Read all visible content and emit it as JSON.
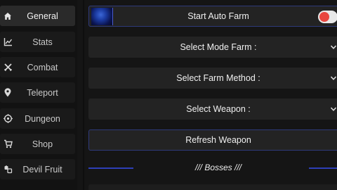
{
  "sidebar": {
    "items": [
      {
        "label": "General",
        "icon": "home-icon",
        "active": true
      },
      {
        "label": "Stats",
        "icon": "chart-icon",
        "active": false
      },
      {
        "label": "Combat",
        "icon": "crossed-swords-icon",
        "active": false
      },
      {
        "label": "Teleport",
        "icon": "location-pin-icon",
        "active": false
      },
      {
        "label": "Dungeon",
        "icon": "target-icon",
        "active": false
      },
      {
        "label": "Shop",
        "icon": "cart-icon",
        "active": false
      },
      {
        "label": "Devil Fruit",
        "icon": "fruit-icon",
        "active": false
      }
    ]
  },
  "main": {
    "auto_farm": {
      "label": "Start Auto Farm",
      "enabled": false
    },
    "select_mode_farm": {
      "label": "Select Mode Farm :"
    },
    "select_farm_method": {
      "label": "Select Farm Method :"
    },
    "select_weapon": {
      "label": "Select Weapon :"
    },
    "refresh_weapon": {
      "label": "Refresh Weapon"
    },
    "bosses_section": {
      "label": "/// Bosses ///"
    }
  },
  "colors": {
    "accent": "#2e3fb8",
    "toggle_off": "#e8463f",
    "row_bg": "#232323",
    "sidebar_bg": "#121212"
  }
}
